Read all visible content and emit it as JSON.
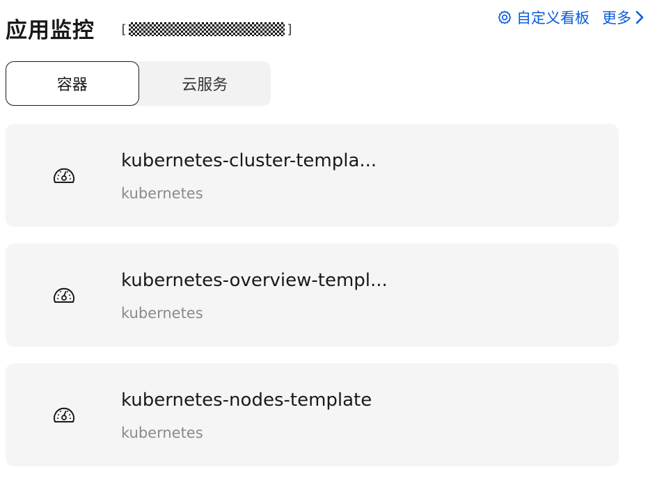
{
  "header": {
    "title": "应用监控",
    "customize_label": "自定义看板",
    "more_label": "更多",
    "bracket_open": "[",
    "bracket_close": "]"
  },
  "tabs": [
    {
      "label": "容器",
      "active": true
    },
    {
      "label": "云服务",
      "active": false
    }
  ],
  "cards": [
    {
      "name": "kubernetes-cluster-templa...",
      "category": "kubernetes",
      "icon": "dashboard-gauge-icon"
    },
    {
      "name": "kubernetes-overview-templ...",
      "category": "kubernetes",
      "icon": "dashboard-gauge-icon"
    },
    {
      "name": "kubernetes-nodes-template",
      "category": "kubernetes",
      "icon": "dashboard-gauge-icon"
    }
  ],
  "colors": {
    "accent": "#0a5bdb",
    "card_bg": "#f5f5f5",
    "tabs_bg": "#f2f2f2",
    "subtitle": "#8a8a8a"
  }
}
